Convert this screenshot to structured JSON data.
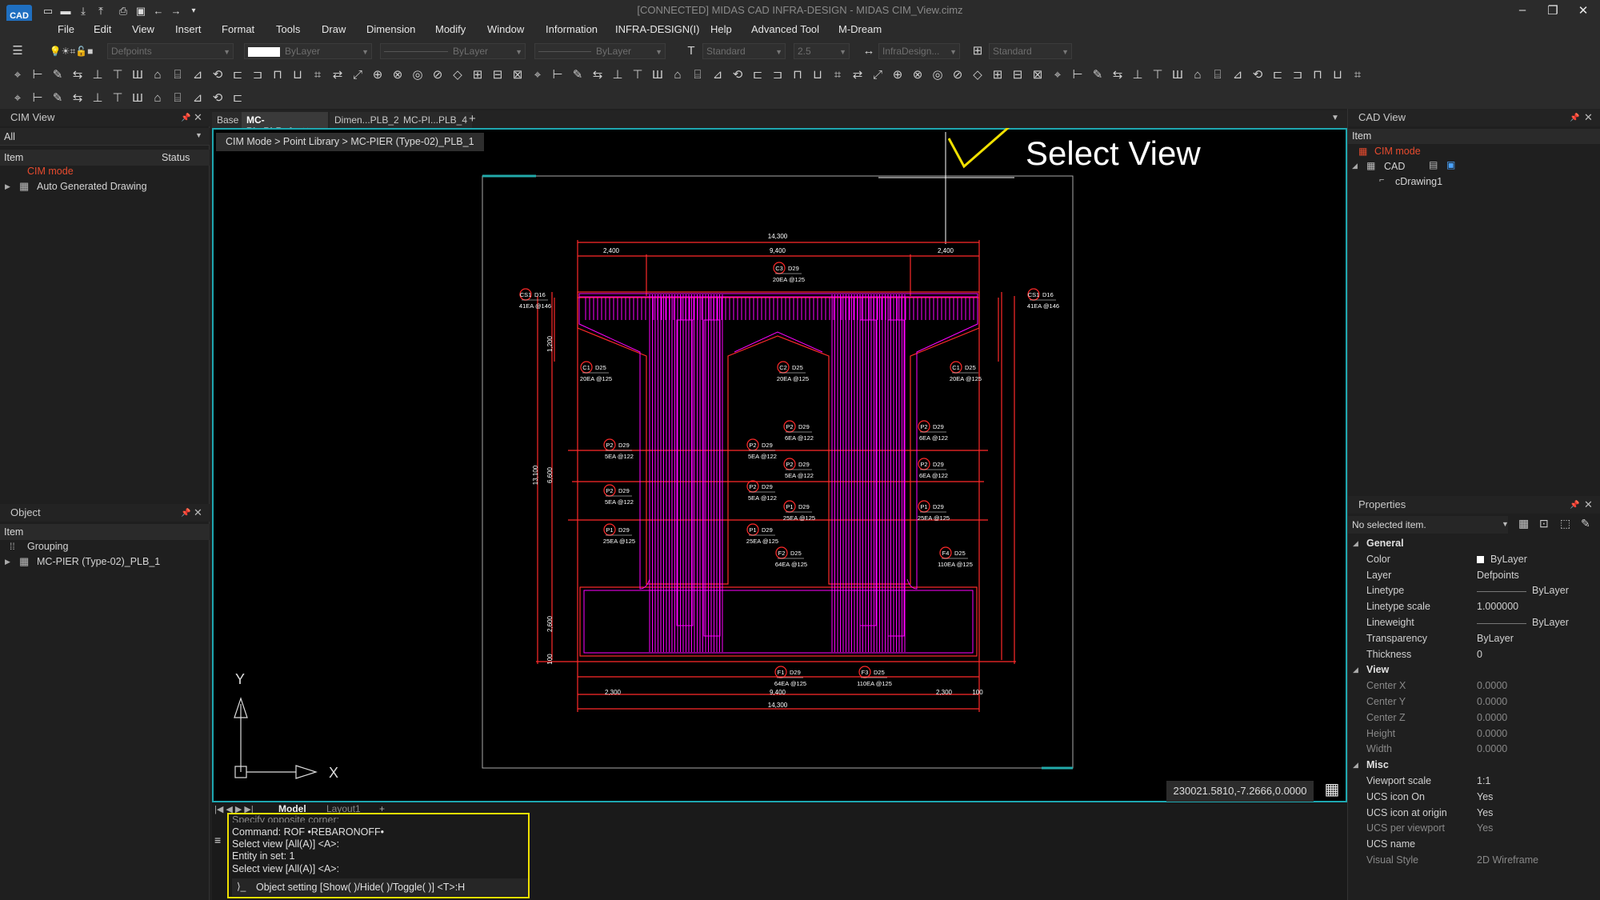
{
  "app": {
    "logo_text": "CAD",
    "title": "[CONNECTED] MIDAS CAD INFRA-DESIGN - MIDAS CIM_View.cimz"
  },
  "menu": [
    "File",
    "Edit",
    "View",
    "Insert",
    "Format",
    "Tools",
    "Draw",
    "Dimension",
    "Modify",
    "Window",
    "Information",
    "INFRA-DESIGN(I)",
    "Help",
    "Advanced Tool",
    "M-Dream"
  ],
  "toolbar": {
    "layer": "Defpoints",
    "color": "ByLayer",
    "linetype": "ByLayer",
    "lineweight": "ByLayer",
    "text_style": "Standard",
    "text_height": "2.5",
    "dim_style": "InfraDesign...",
    "table_style": "Standard"
  },
  "cim_view": {
    "title": "CIM View",
    "filter": "All",
    "col_item": "Item",
    "col_status": "Status",
    "items": [
      "CIM mode",
      "Auto Generated Drawing"
    ]
  },
  "object_panel": {
    "title": "Object",
    "col_item": "Item",
    "items": [
      "Grouping",
      "MC-PIER (Type-02)_PLB_1"
    ]
  },
  "tabs": [
    "Base",
    "MC-PI...PLB_1",
    "Dimen...PLB_2",
    "MC-PI...PLB_4"
  ],
  "breadcrumb": "CIM Mode > Point Library > MC-PIER (Type-02)_PLB_1",
  "annotation": "Select View",
  "drawing": {
    "dims": [
      "14,300",
      "2,400",
      "9,400",
      "2,400",
      "1,200",
      "13,100",
      "6,600",
      "2,600",
      "100",
      "2,300",
      "9,400",
      "2,300",
      "100",
      "14,300"
    ],
    "tags": [
      {
        "id": "CS1",
        "dia": "D16",
        "q": "41EA @146"
      },
      {
        "id": "CS1",
        "dia": "D16",
        "q": "41EA @146"
      },
      {
        "id": "C3",
        "dia": "D29",
        "q": "20EA @125"
      },
      {
        "id": "C1",
        "dia": "D25",
        "q": "20EA @125"
      },
      {
        "id": "C2",
        "dia": "D25",
        "q": "20EA @125"
      },
      {
        "id": "C1",
        "dia": "D25",
        "q": "20EA @125"
      },
      {
        "id": "P2",
        "dia": "D29",
        "q": "6EA @122"
      },
      {
        "id": "P2",
        "dia": "D29",
        "q": "5EA @122"
      },
      {
        "id": "P2",
        "dia": "D29",
        "q": "5EA @122"
      },
      {
        "id": "P2",
        "dia": "D29",
        "q": "6EA @122"
      },
      {
        "id": "P2",
        "dia": "D29",
        "q": "5EA @122"
      },
      {
        "id": "P2",
        "dia": "D29",
        "q": "6EA @122"
      },
      {
        "id": "P2",
        "dia": "D29",
        "q": "5EA @122"
      },
      {
        "id": "P2",
        "dia": "D29",
        "q": "5EA @122"
      },
      {
        "id": "P1",
        "dia": "D29",
        "q": "25EA @125"
      },
      {
        "id": "P1",
        "dia": "D29",
        "q": "25EA @125"
      },
      {
        "id": "P1",
        "dia": "D29",
        "q": "25EA @125"
      },
      {
        "id": "P1",
        "dia": "D29",
        "q": "25EA @125"
      },
      {
        "id": "F2",
        "dia": "D25",
        "q": "64EA @125"
      },
      {
        "id": "F4",
        "dia": "D25",
        "q": "110EA @125"
      },
      {
        "id": "F1",
        "dia": "D29",
        "q": "64EA @125"
      },
      {
        "id": "F3",
        "dia": "D25",
        "q": "110EA @125"
      }
    ]
  },
  "axes": {
    "y": "Y",
    "x": "X"
  },
  "coords": "230021.5810,-7.2666,0.0000",
  "layout_tabs": [
    "Model",
    "Layout1"
  ],
  "command": {
    "lines": [
      "Specify opposite corner:",
      "Command:  ROF •REBARONOFF•",
      "Select view [All(A)] <A>:",
      "Entity in set: 1",
      "Select view [All(A)] <A>:"
    ],
    "prompt": "Object setting [Show(  )/Hide(  )/Toggle(  )] <T>:H"
  },
  "cad_view": {
    "title": "CAD View",
    "col_item": "Item",
    "items": [
      "CIM mode",
      "CAD",
      "cDrawing1"
    ]
  },
  "properties": {
    "title": "Properties",
    "selection": "No selected item.",
    "sections": [
      {
        "name": "General",
        "rows": [
          [
            "Color",
            "ByLayer"
          ],
          [
            "Layer",
            "Defpoints"
          ],
          [
            "Linetype",
            "ByLayer"
          ],
          [
            "Linetype scale",
            "1.000000"
          ],
          [
            "Lineweight",
            "ByLayer"
          ],
          [
            "Transparency",
            "ByLayer"
          ],
          [
            "Thickness",
            "0"
          ]
        ]
      },
      {
        "name": "View",
        "rows": [
          [
            "Center X",
            "0.0000"
          ],
          [
            "Center Y",
            "0.0000"
          ],
          [
            "Center Z",
            "0.0000"
          ],
          [
            "Height",
            "0.0000"
          ],
          [
            "Width",
            "0.0000"
          ]
        ]
      },
      {
        "name": "Misc",
        "rows": [
          [
            "Viewport scale",
            "1:1"
          ],
          [
            "UCS icon On",
            "Yes"
          ],
          [
            "UCS icon at origin",
            "Yes"
          ],
          [
            "UCS per viewport",
            "Yes"
          ],
          [
            "UCS name",
            ""
          ],
          [
            "Visual Style",
            "2D Wireframe"
          ]
        ]
      }
    ]
  }
}
